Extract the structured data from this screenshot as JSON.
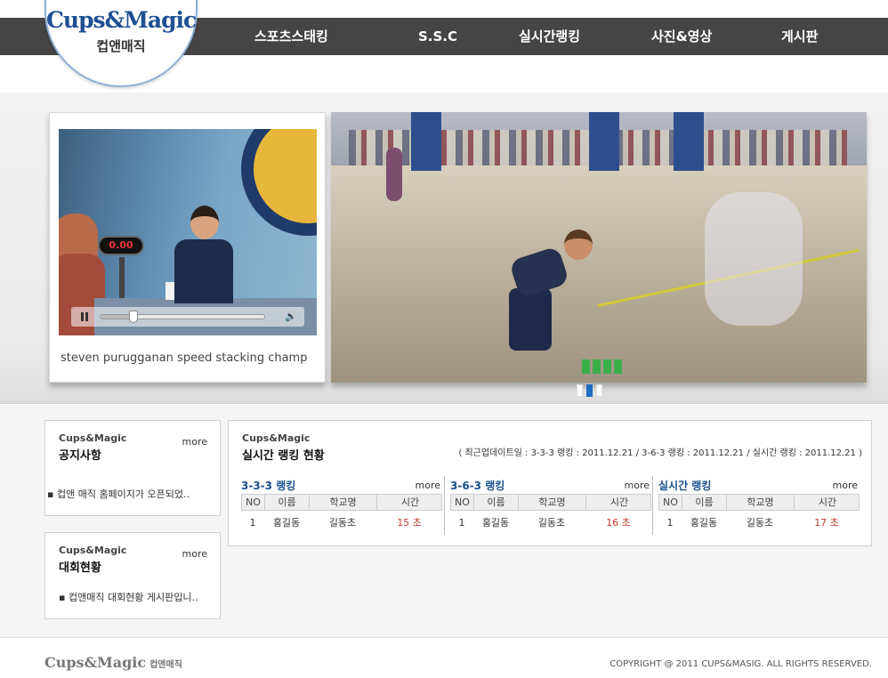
{
  "brand": {
    "logo_main": "Cups&Magic",
    "logo_sub": "컵앤매직"
  },
  "nav": {
    "items": [
      "스포츠스태킹",
      "S.S.C",
      "실시간랭킹",
      "사진&영상",
      "게시판"
    ]
  },
  "video": {
    "timer": "0.00",
    "caption": "steven purugganan speed stacking champ",
    "progress": 0.2,
    "pause_icon": "pause-icon",
    "volume_icon": "volume-icon"
  },
  "slider": {
    "count": 3,
    "active": 1
  },
  "notice": {
    "brand": "Cups&Magic",
    "title": "공지사항",
    "more": "more",
    "items": [
      "컵앤 매직 홈페이지가 오픈되었.."
    ]
  },
  "competition": {
    "brand": "Cups&Magic",
    "title": "대회현황",
    "more": "more",
    "items": [
      "컵앤매직 대회현황 게시판입니.."
    ]
  },
  "ranking": {
    "brand": "Cups&Magic",
    "title": "실시간 랭킹 현황",
    "update": "( 최근업데이트일 : 3-3-3 랭킹 : 2011.12.21 / 3-6-3 랭킹 : 2011.12.21 / 실시간 랭킹 : 2011.12.21 )",
    "columns": [
      "NO",
      "이름",
      "학교명",
      "시간"
    ],
    "tables": [
      {
        "title": "3-3-3 랭킹",
        "more": "more",
        "row": [
          "1",
          "홍길동",
          "길동초",
          "15 초"
        ]
      },
      {
        "title": "3-6-3 랭킹",
        "more": "more",
        "row": [
          "1",
          "홍길동",
          "길동초",
          "16 초"
        ]
      },
      {
        "title": "실시간 랭킹",
        "more": "more",
        "row": [
          "1",
          "홍길동",
          "길동초",
          "17 초"
        ]
      }
    ]
  },
  "footer": {
    "logo": "Cups&Magic",
    "logo_sub": "컵앤매직",
    "copyright": "COPYRIGHT @ 2011 CUPS&MASIG. ALL RIGHTS RESERVED."
  }
}
